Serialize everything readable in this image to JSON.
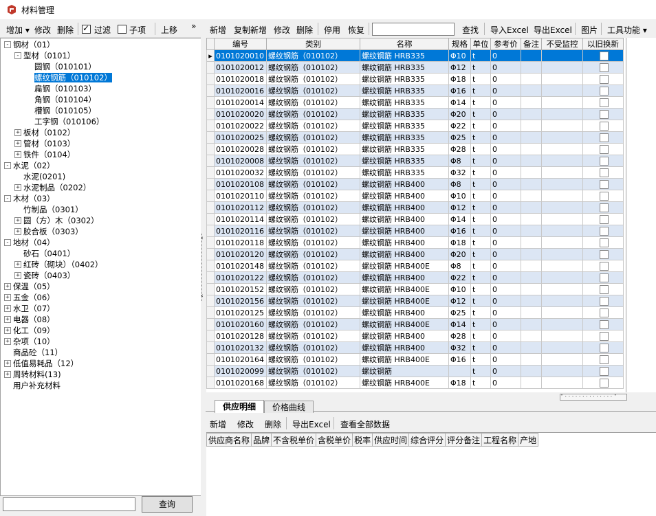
{
  "window": {
    "title": "材料管理"
  },
  "left_toolbar": {
    "add": "增加",
    "edit": "修改",
    "delete": "删除",
    "filter": "过滤",
    "filter_checked": true,
    "children": "子项",
    "children_checked": false,
    "move_up": "上移",
    "more": "»"
  },
  "tree": [
    {
      "label": "钢材（01）",
      "level": 0,
      "exp": "-"
    },
    {
      "label": "型材（0101）",
      "level": 1,
      "exp": "-"
    },
    {
      "label": "圆钢（010101）",
      "level": 2,
      "exp": ""
    },
    {
      "label": "螺纹钢筋（010102）",
      "level": 2,
      "exp": "",
      "selected": true
    },
    {
      "label": "扁钢（010103）",
      "level": 2,
      "exp": ""
    },
    {
      "label": "角钢（010104）",
      "level": 2,
      "exp": ""
    },
    {
      "label": "槽钢（010105）",
      "level": 2,
      "exp": ""
    },
    {
      "label": "工字钢（010106）",
      "level": 2,
      "exp": ""
    },
    {
      "label": "板材（0102）",
      "level": 1,
      "exp": "+"
    },
    {
      "label": "管材（0103）",
      "level": 1,
      "exp": "+"
    },
    {
      "label": "铁件（0104）",
      "level": 1,
      "exp": "+"
    },
    {
      "label": "水泥（02）",
      "level": 0,
      "exp": "-"
    },
    {
      "label": "水泥(0201)",
      "level": 1,
      "exp": ""
    },
    {
      "label": "水泥制品（0202）",
      "level": 1,
      "exp": "+"
    },
    {
      "label": "木材（03）",
      "level": 0,
      "exp": "-"
    },
    {
      "label": "竹制品（0301）",
      "level": 1,
      "exp": ""
    },
    {
      "label": "圆（方）木（0302）",
      "level": 1,
      "exp": "+"
    },
    {
      "label": "胶合板（0303）",
      "level": 1,
      "exp": "+"
    },
    {
      "label": "地材（04）",
      "level": 0,
      "exp": "-"
    },
    {
      "label": "砂石（0401）",
      "level": 1,
      "exp": ""
    },
    {
      "label": "红砖（砌块）（0402）",
      "level": 1,
      "exp": "+"
    },
    {
      "label": "瓷砖（0403）",
      "level": 1,
      "exp": "+"
    },
    {
      "label": "保温（05）",
      "level": 0,
      "exp": "+"
    },
    {
      "label": "五金（06）",
      "level": 0,
      "exp": "+"
    },
    {
      "label": "水卫（07）",
      "level": 0,
      "exp": "+"
    },
    {
      "label": "电器（08）",
      "level": 0,
      "exp": "+"
    },
    {
      "label": "化工（09）",
      "level": 0,
      "exp": "+"
    },
    {
      "label": "杂项（10）",
      "level": 0,
      "exp": "+"
    },
    {
      "label": "商品砼（11）",
      "level": 0,
      "exp": ""
    },
    {
      "label": "低值易耗品（12）",
      "level": 0,
      "exp": "+"
    },
    {
      "label": "周转材料(13)",
      "level": 0,
      "exp": "+"
    },
    {
      "label": "用户补充材料",
      "level": 0,
      "exp": ""
    }
  ],
  "search": {
    "button": "查询",
    "value": ""
  },
  "right_toolbar": {
    "new": "新增",
    "copy_new": "复制新增",
    "edit": "修改",
    "delete": "删除",
    "disable": "停用",
    "restore": "恢复",
    "find": "查找",
    "import_excel": "导入Excel",
    "export_excel": "导出Excel",
    "picture": "图片",
    "tools": "工具功能"
  },
  "grid": {
    "columns": [
      "编号",
      "类别",
      "名称",
      "规格",
      "单位",
      "参考价",
      "备注",
      "不受监控",
      "以旧换新"
    ],
    "rows": [
      {
        "code": "0101020010",
        "cat": "螺纹钢筋（010102）",
        "name": "螺纹钢筋  HRB335",
        "spec": "Φ10",
        "unit": "t",
        "price": "0"
      },
      {
        "code": "0101020012",
        "cat": "螺纹钢筋（010102）",
        "name": "螺纹钢筋  HRB335",
        "spec": "Φ12",
        "unit": "t",
        "price": "0"
      },
      {
        "code": "0101020018",
        "cat": "螺纹钢筋（010102）",
        "name": "螺纹钢筋  HRB335",
        "spec": "Φ18",
        "unit": "t",
        "price": "0"
      },
      {
        "code": "0101020016",
        "cat": "螺纹钢筋（010102）",
        "name": "螺纹钢筋  HRB335",
        "spec": "Φ16",
        "unit": "t",
        "price": "0"
      },
      {
        "code": "0101020014",
        "cat": "螺纹钢筋（010102）",
        "name": "螺纹钢筋  HRB335",
        "spec": "Φ14",
        "unit": "t",
        "price": "0"
      },
      {
        "code": "0101020020",
        "cat": "螺纹钢筋（010102）",
        "name": "螺纹钢筋  HRB335",
        "spec": "Φ20",
        "unit": "t",
        "price": "0"
      },
      {
        "code": "0101020022",
        "cat": "螺纹钢筋（010102）",
        "name": "螺纹钢筋  HRB335",
        "spec": "Φ22",
        "unit": "t",
        "price": "0"
      },
      {
        "code": "0101020025",
        "cat": "螺纹钢筋（010102）",
        "name": "螺纹钢筋  HRB335",
        "spec": "Φ25",
        "unit": "t",
        "price": "0"
      },
      {
        "code": "0101020028",
        "cat": "螺纹钢筋（010102）",
        "name": "螺纹钢筋  HRB335",
        "spec": "Φ28",
        "unit": "t",
        "price": "0"
      },
      {
        "code": "0101020008",
        "cat": "螺纹钢筋（010102）",
        "name": "螺纹钢筋  HRB335",
        "spec": "Φ8",
        "unit": "t",
        "price": "0"
      },
      {
        "code": "0101020032",
        "cat": "螺纹钢筋（010102）",
        "name": "螺纹钢筋  HRB335",
        "spec": "Φ32",
        "unit": "t",
        "price": "0"
      },
      {
        "code": "0101020108",
        "cat": "螺纹钢筋（010102）",
        "name": "螺纹钢筋  HRB400",
        "spec": "Φ8",
        "unit": "t",
        "price": "0"
      },
      {
        "code": "0101020110",
        "cat": "螺纹钢筋（010102）",
        "name": "螺纹钢筋  HRB400",
        "spec": "Φ10",
        "unit": "t",
        "price": "0"
      },
      {
        "code": "0101020112",
        "cat": "螺纹钢筋（010102）",
        "name": "螺纹钢筋  HRB400",
        "spec": "Φ12",
        "unit": "t",
        "price": "0"
      },
      {
        "code": "0101020114",
        "cat": "螺纹钢筋（010102）",
        "name": "螺纹钢筋  HRB400",
        "spec": "Φ14",
        "unit": "t",
        "price": "0"
      },
      {
        "code": "0101020116",
        "cat": "螺纹钢筋（010102）",
        "name": "螺纹钢筋  HRB400",
        "spec": "Φ16",
        "unit": "t",
        "price": "0"
      },
      {
        "code": "0101020118",
        "cat": "螺纹钢筋（010102）",
        "name": "螺纹钢筋  HRB400",
        "spec": "Φ18",
        "unit": "t",
        "price": "0"
      },
      {
        "code": "0101020120",
        "cat": "螺纹钢筋（010102）",
        "name": "螺纹钢筋  HRB400",
        "spec": "Φ20",
        "unit": "t",
        "price": "0"
      },
      {
        "code": "0101020148",
        "cat": "螺纹钢筋（010102）",
        "name": "螺纹钢筋  HRB400E",
        "spec": "Φ8",
        "unit": "t",
        "price": "0"
      },
      {
        "code": "0101020122",
        "cat": "螺纹钢筋（010102）",
        "name": "螺纹钢筋  HRB400",
        "spec": "Φ22",
        "unit": "t",
        "price": "0"
      },
      {
        "code": "0101020152",
        "cat": "螺纹钢筋（010102）",
        "name": "螺纹钢筋  HRB400E",
        "spec": "Φ10",
        "unit": "t",
        "price": "0"
      },
      {
        "code": "0101020156",
        "cat": "螺纹钢筋（010102）",
        "name": "螺纹钢筋  HRB400E",
        "spec": "Φ12",
        "unit": "t",
        "price": "0"
      },
      {
        "code": "0101020125",
        "cat": "螺纹钢筋（010102）",
        "name": "螺纹钢筋  HRB400",
        "spec": "Φ25",
        "unit": "t",
        "price": "0"
      },
      {
        "code": "0101020160",
        "cat": "螺纹钢筋（010102）",
        "name": "螺纹钢筋  HRB400E",
        "spec": "Φ14",
        "unit": "t",
        "price": "0"
      },
      {
        "code": "0101020128",
        "cat": "螺纹钢筋（010102）",
        "name": "螺纹钢筋  HRB400",
        "spec": "Φ28",
        "unit": "t",
        "price": "0"
      },
      {
        "code": "0101020132",
        "cat": "螺纹钢筋（010102）",
        "name": "螺纹钢筋  HRB400",
        "spec": "Φ32",
        "unit": "t",
        "price": "0"
      },
      {
        "code": "0101020164",
        "cat": "螺纹钢筋（010102）",
        "name": "螺纹钢筋  HRB400E",
        "spec": "Φ16",
        "unit": "t",
        "price": "0"
      },
      {
        "code": "0101020099",
        "cat": "螺纹钢筋（010102）",
        "name": "螺纹钢筋",
        "spec": "",
        "unit": "t",
        "price": "0"
      },
      {
        "code": "0101020168",
        "cat": "螺纹钢筋（010102）",
        "name": "螺纹钢筋  HRB400E",
        "spec": "Φ18",
        "unit": "t",
        "price": "0"
      }
    ]
  },
  "bottom_tabs": {
    "supply_detail": "供应明细",
    "price_curve": "价格曲线"
  },
  "bottom_toolbar": {
    "new": "新增",
    "edit": "修改",
    "delete": "删除",
    "export_excel": "导出Excel",
    "view_all": "查看全部数据"
  },
  "supply_columns": [
    "供应商名称",
    "品牌",
    "不含税单价",
    "含税单价",
    "税率",
    "供应时间",
    "综合评分",
    "评分备注",
    "工程名称",
    "产地"
  ],
  "colors": {
    "selection": "#0078d7",
    "alt_row": "#dce6f4"
  },
  "icons": [
    "app-icon",
    "dropdown-arrow-icon",
    "expand-icon",
    "collapse-icon",
    "row-pointer-icon",
    "splitter-arrow-icon"
  ]
}
